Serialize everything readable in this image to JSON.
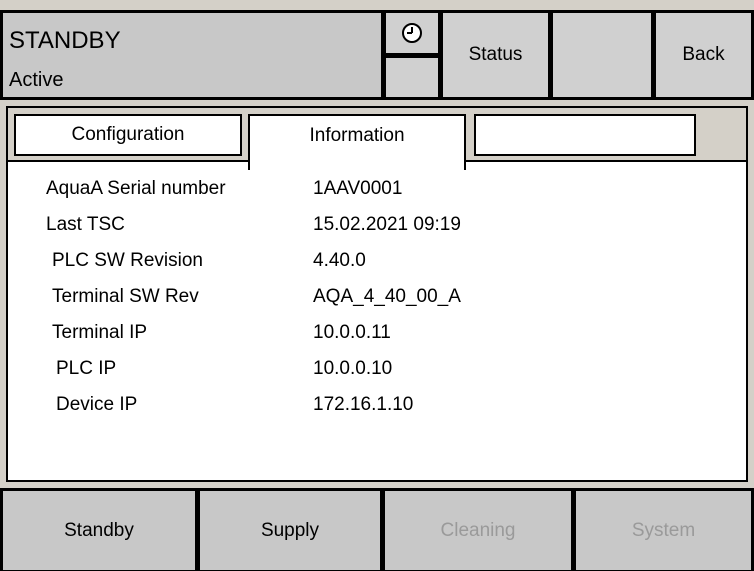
{
  "header": {
    "mode": "STANDBY",
    "state": "Active",
    "clock_icon": "clock-icon",
    "status_label": "Status",
    "back_label": "Back"
  },
  "tabs": [
    {
      "label": "Configuration",
      "selected": false
    },
    {
      "label": "Information",
      "selected": true
    },
    {
      "label": "",
      "selected": false
    }
  ],
  "info": [
    {
      "label": "AquaA Serial number",
      "value": "1AAV0001"
    },
    {
      "label": "Last TSC",
      "value": "15.02.2021  09:19"
    },
    {
      "label": "PLC SW Revision",
      "value": "4.40.0"
    },
    {
      "label": "Terminal SW Rev",
      "value": "AQA_4_40_00_A"
    },
    {
      "label": "Terminal IP",
      "value": "10.0.0.11"
    },
    {
      "label": "PLC IP",
      "value": "10.0.0.10"
    },
    {
      "label": "Device IP",
      "value": "172.16.1.10"
    }
  ],
  "nav": [
    {
      "label": "Standby",
      "enabled": true
    },
    {
      "label": "Supply",
      "enabled": true
    },
    {
      "label": "Cleaning",
      "enabled": false
    },
    {
      "label": "System",
      "enabled": false
    }
  ],
  "colors": {
    "background": "#d4d0c8",
    "panel": "#ffffff",
    "disabled_text": "#9a9a9a"
  }
}
